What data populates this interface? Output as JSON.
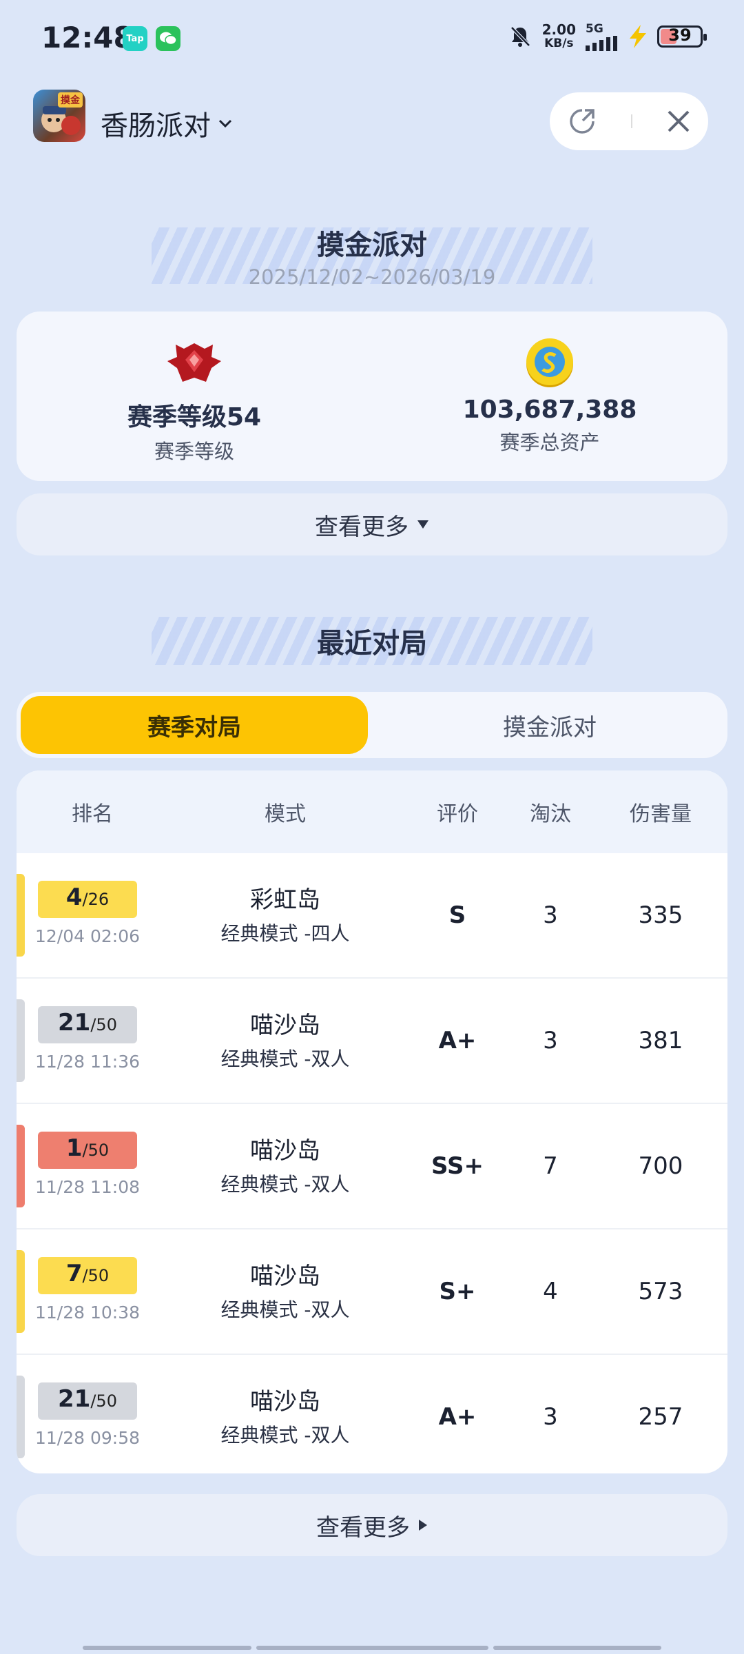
{
  "status_bar": {
    "time": "12:48",
    "app_badges": [
      "Tap",
      "WeChat"
    ],
    "net_speed_value": "2.00",
    "net_speed_unit": "KB/s",
    "network": "5G",
    "battery": 39
  },
  "header": {
    "game_icon_tag": "摸金",
    "game_name": "香肠派对",
    "share_icon": "share-icon",
    "close_icon": "close-icon"
  },
  "season": {
    "title": "摸金派对",
    "date_range": "2025/12/02~2026/03/19",
    "level_value": "赛季等级54",
    "level_label": "赛季等级",
    "assets_value": "103,687,388",
    "assets_label": "赛季总资产",
    "more_label": "查看更多"
  },
  "recent": {
    "title": "最近对局",
    "tabs": [
      {
        "label": "赛季对局",
        "active": true
      },
      {
        "label": "摸金派对",
        "active": false
      }
    ],
    "columns": [
      "排名",
      "模式",
      "评价",
      "淘汰",
      "伤害量"
    ],
    "rows": [
      {
        "rank": "4",
        "total": "/26",
        "time": "12/04 02:06",
        "map": "彩虹岛",
        "mode": "经典模式 -四人",
        "grade": "S",
        "kills": "3",
        "damage": "335",
        "accent": "#f9d64a"
      },
      {
        "rank": "21",
        "total": "/50",
        "time": "11/28 11:36",
        "map": "喵沙岛",
        "mode": "经典模式 -双人",
        "grade": "A+",
        "kills": "3",
        "damage": "381",
        "accent": "#d5d8de"
      },
      {
        "rank": "1",
        "total": "/50",
        "time": "11/28 11:08",
        "map": "喵沙岛",
        "mode": "经典模式 -双人",
        "grade": "SS+",
        "kills": "7",
        "damage": "700",
        "accent": "#ee7d6d"
      },
      {
        "rank": "7",
        "total": "/50",
        "time": "11/28 10:38",
        "map": "喵沙岛",
        "mode": "经典模式 -双人",
        "grade": "S+",
        "kills": "4",
        "damage": "573",
        "accent": "#f9d64a"
      },
      {
        "rank": "21",
        "total": "/50",
        "time": "11/28 09:58",
        "map": "喵沙岛",
        "mode": "经典模式 -双人",
        "grade": "A+",
        "kills": "3",
        "damage": "257",
        "accent": "#d5d8de"
      }
    ],
    "more_label": "查看更多"
  }
}
